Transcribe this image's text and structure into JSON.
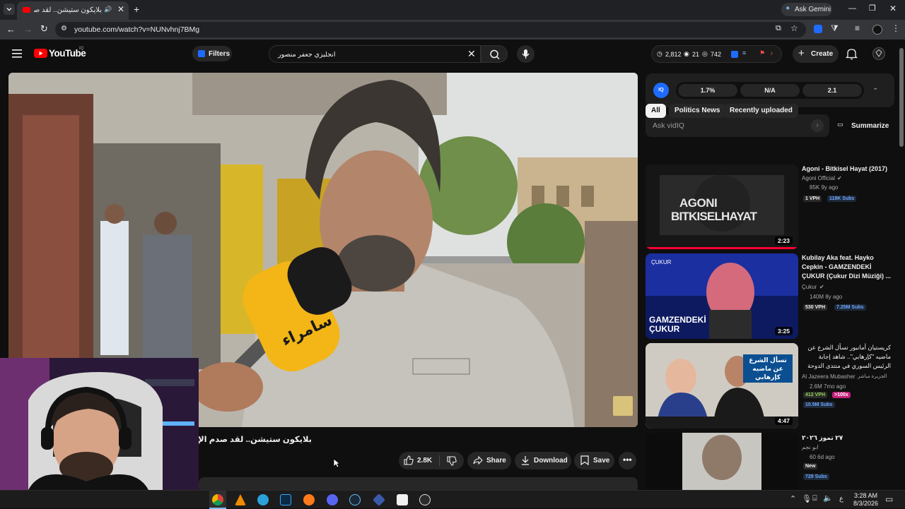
{
  "browser": {
    "tab_title": "بلايكون ستيشن.. لقد صدم الإنكليز م",
    "url": "youtube.com/watch?v=NUNvhnj7BMg",
    "ask_gemini": "Ask Gemini"
  },
  "youtube": {
    "logo_text": "YouTube",
    "country": "IQ",
    "filters_label": "Filters",
    "search_value": "انجليزي جعفر منصور",
    "stats": {
      "views": "2,812",
      "comments": "21",
      "watching": "742"
    },
    "create_label": "Create"
  },
  "video": {
    "title": "بلايكون ستيشن.. لقد صدم الإنكليز م",
    "likes": "2.8K",
    "share_label": "Share",
    "download_label": "Download",
    "save_label": "Save",
    "mic_brand": "سامراء"
  },
  "vidiq": {
    "metrics": [
      "1.7%",
      "N/A",
      "2.1"
    ],
    "ask_placeholder": "Ask vidIQ",
    "summarize_label": "Summarize"
  },
  "chips": [
    "All",
    "Politics News",
    "Recently uploaded"
  ],
  "recommendations": [
    {
      "title": "Agoni - Bitkisel Hayat (2017)",
      "channel": "Agoni Official",
      "verified": true,
      "stats": "85K  9y ago",
      "vph": "1 VPH",
      "subs": "118K Subs",
      "duration": "2:23",
      "thumb_text": "AGONI\nBITKISELHAYAT"
    },
    {
      "title": "Kubilay Aka feat. Hayko Cepkin - GAMZENDEKİ ÇUKUR (Çukur Dizi Müziği) ...",
      "channel": "Çukur",
      "verified": true,
      "stats": "140M  8y ago",
      "vph": "530 VPH",
      "subs": "7.25M Subs",
      "duration": "3:25",
      "thumb_text": "GAMZENDEKİ ÇUKUR"
    },
    {
      "title": "كريستيان أمانبور تسأل الشرع عن ماضيه \"كإرهابي\".. شاهد إجابة الرئيس السوري في منتدى الدوحة",
      "channel": "Al Jazeera Mubasher",
      "channel_sub": "الجزيرة مباشر",
      "verified": false,
      "stats": "2.6M  7mo ago",
      "vph": "412 VPH",
      "extra": ">100x",
      "subs": "10.5M Subs",
      "duration": "4:47",
      "thumb_text": "تسأل الشرع عن ماضيه كإرهابي"
    },
    {
      "title": "٢٧ تموز ٢٠٢٦",
      "channel": "ابو نجم",
      "verified": false,
      "stats": "60  6d ago",
      "new_label": "New",
      "subs": "729 Subs"
    }
  ],
  "taskbar": {
    "time": "3:28 AM",
    "date": "8/3/2026",
    "lang": "ع"
  },
  "colors": {
    "youtube_red": "#ff0000",
    "vidiq_blue": "#1e6bff",
    "vph_green": "#8fd14f"
  }
}
